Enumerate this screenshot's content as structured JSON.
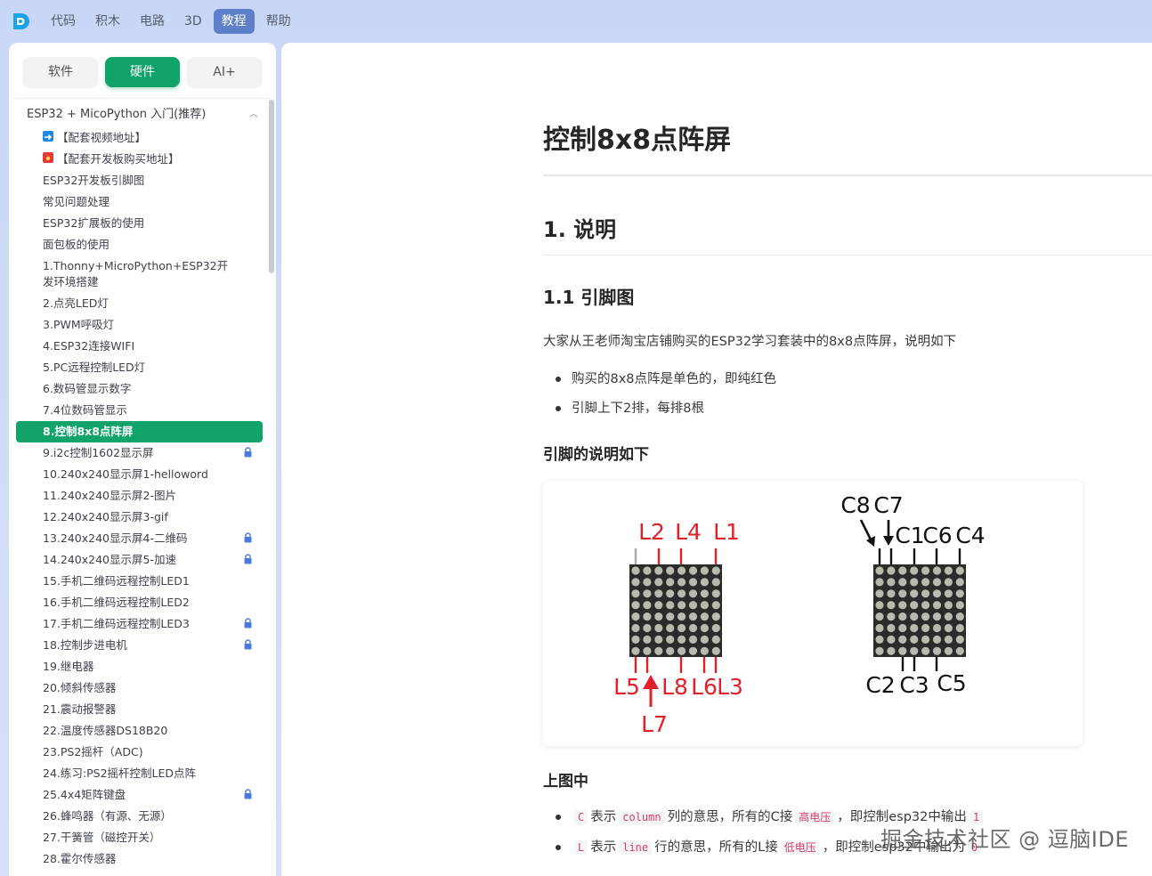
{
  "topnav": {
    "items": [
      {
        "label": "代码"
      },
      {
        "label": "积木"
      },
      {
        "label": "电路"
      },
      {
        "label": "3D"
      },
      {
        "label": "教程"
      },
      {
        "label": "帮助"
      }
    ],
    "active_index": 4
  },
  "sidebar": {
    "tabs": [
      {
        "label": "软件"
      },
      {
        "label": "硬件"
      },
      {
        "label": "AI+"
      }
    ],
    "active_tab": 1,
    "group_title": "ESP32 + MicoPython 入门(推荐)",
    "items": [
      {
        "label": "【配套视频地址】",
        "icon": "arrow-right-icon"
      },
      {
        "label": "【配套开发板购买地址】",
        "icon": "red-flag-icon"
      },
      {
        "label": "ESP32开发板引脚图"
      },
      {
        "label": "常见问题处理"
      },
      {
        "label": "ESP32扩展板的使用"
      },
      {
        "label": "面包板的使用"
      },
      {
        "label": "1.Thonny+MicroPython+ESP32开发环境搭建"
      },
      {
        "label": "2.点亮LED灯"
      },
      {
        "label": "3.PWM呼吸灯"
      },
      {
        "label": "4.ESP32连接WIFI"
      },
      {
        "label": "5.PC远程控制LED灯"
      },
      {
        "label": "6.数码管显示数字"
      },
      {
        "label": "7.4位数码管显示"
      },
      {
        "label": "8.控制8x8点阵屏",
        "active": true
      },
      {
        "label": "9.i2c控制1602显示屏",
        "locked": true
      },
      {
        "label": "10.240x240显示屏1-helloword"
      },
      {
        "label": "11.240x240显示屏2-图片"
      },
      {
        "label": "12.240x240显示屏3-gif"
      },
      {
        "label": "13.240x240显示屏4-二维码",
        "locked": true
      },
      {
        "label": "14.240x240显示屏5-加速",
        "locked": true
      },
      {
        "label": "15.手机二维码远程控制LED1"
      },
      {
        "label": "16.手机二维码远程控制LED2"
      },
      {
        "label": "17.手机二维码远程控制LED3",
        "locked": true
      },
      {
        "label": "18.控制步进电机",
        "locked": true
      },
      {
        "label": "19.继电器"
      },
      {
        "label": "20.倾斜传感器"
      },
      {
        "label": "21.震动报警器"
      },
      {
        "label": "22.温度传感器DS18B20"
      },
      {
        "label": "23.PS2摇杆（ADC)"
      },
      {
        "label": "24.练习:PS2摇杆控制LED点阵"
      },
      {
        "label": "25.4x4矩阵键盘",
        "locked": true
      },
      {
        "label": "26.蜂鸣器（有源、无源）"
      },
      {
        "label": "27.干簧管（磁控开关）"
      },
      {
        "label": "28.霍尔传感器"
      }
    ]
  },
  "main": {
    "title": "控制8x8点阵屏",
    "section1": "1. 说明",
    "section1_1": "1.1 引脚图",
    "intro": "大家从王老师淘宝店铺购买的ESP32学习套装中的8x8点阵屏，说明如下",
    "bullets": [
      "购买的8x8点阵是单色的，即纯红色",
      "引脚上下2排，每排8根"
    ],
    "pin_heading": "引脚的说明如下",
    "figure": {
      "left_top_labels": [
        "L2",
        "L4",
        "L1"
      ],
      "left_bottom_labels": [
        "L5",
        "L8",
        "L6",
        "L3"
      ],
      "left_extra_label": "L7",
      "right_top_labels_upper": [
        "C8",
        "C7"
      ],
      "right_top_labels": [
        "C1",
        "C6",
        "C4"
      ],
      "right_bottom_labels": [
        "C2",
        "C3",
        "C5"
      ],
      "label_color_left": "#e0202a",
      "label_color_right": "#111111"
    },
    "above_heading": "上图中",
    "row1": {
      "code1": "C",
      "t1": "表示",
      "code2": "column",
      "t2": "列的意思，所有的C接",
      "code3": "高电压",
      "t3": "，即控制esp32中输出",
      "code4": "1"
    },
    "row2": {
      "code1": "L",
      "t1": "表示",
      "code2": "line",
      "t2": "行的意思，所有的L接",
      "code3": "低电压",
      "t3": "，即控制esp32中输出为",
      "code4": "0"
    },
    "watermark": "掘金技术社区 @ 逗脑IDE"
  },
  "colors": {
    "accent": "#12a36a",
    "nav_active": "#5e7fc9",
    "lock": "#4a7bd8"
  }
}
